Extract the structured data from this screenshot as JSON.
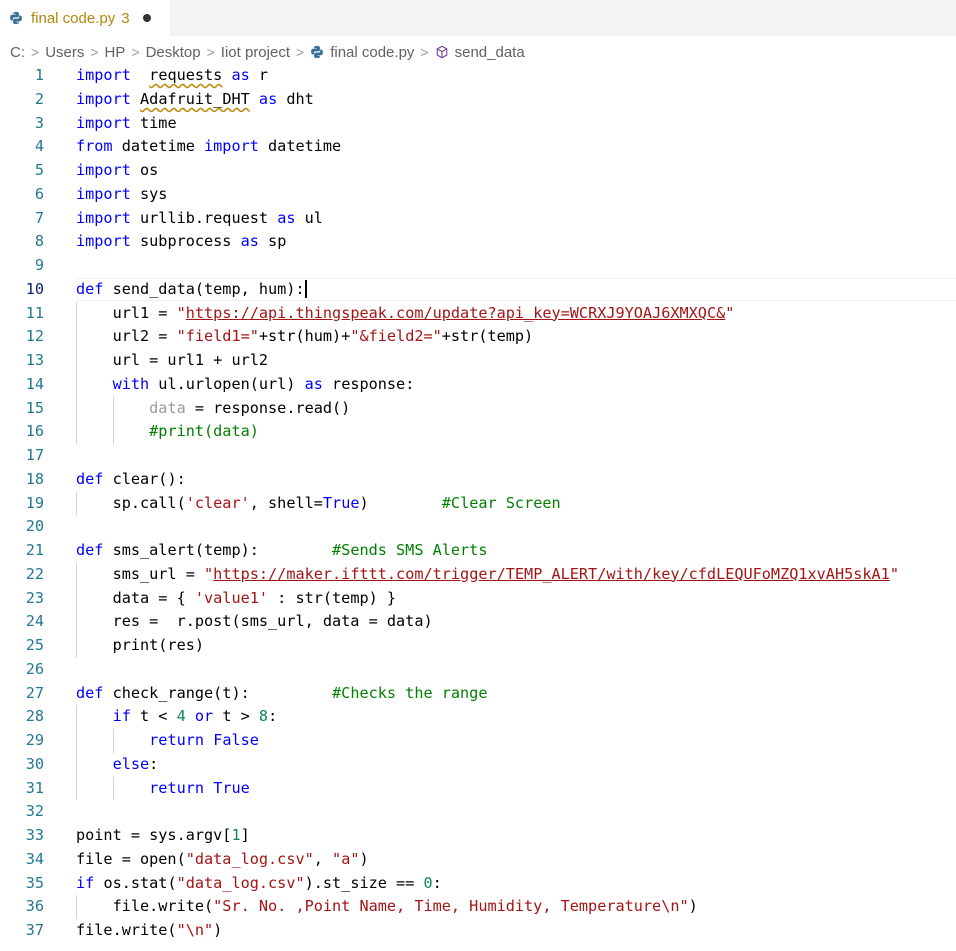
{
  "tab": {
    "filename": "final code.py",
    "problems": "3"
  },
  "breadcrumb": [
    "C:",
    "Users",
    "HP",
    "Desktop",
    "Iiot project",
    "final code.py",
    "send_data"
  ],
  "colors": {
    "keyword": "#0000ff",
    "string": "#a31515",
    "comment": "#008000",
    "number": "#098658",
    "line_number": "#237893"
  },
  "code_lines": [
    {
      "n": "1",
      "t": [
        [
          "kw",
          "import"
        ],
        [
          "",
          "  "
        ],
        [
          "sq",
          "requests"
        ],
        [
          "",
          " "
        ],
        [
          "kw",
          "as"
        ],
        [
          "",
          " r"
        ]
      ]
    },
    {
      "n": "2",
      "t": [
        [
          "kw",
          "import"
        ],
        [
          "",
          " "
        ],
        [
          "sq",
          "Adafruit_DHT"
        ],
        [
          "",
          " "
        ],
        [
          "kw",
          "as"
        ],
        [
          "",
          " dht"
        ]
      ]
    },
    {
      "n": "3",
      "t": [
        [
          "kw",
          "import"
        ],
        [
          "",
          " time"
        ]
      ]
    },
    {
      "n": "4",
      "t": [
        [
          "kw",
          "from"
        ],
        [
          "",
          " datetime "
        ],
        [
          "kw",
          "import"
        ],
        [
          "",
          " datetime"
        ]
      ]
    },
    {
      "n": "5",
      "t": [
        [
          "kw",
          "import"
        ],
        [
          "",
          " os"
        ]
      ]
    },
    {
      "n": "6",
      "t": [
        [
          "kw",
          "import"
        ],
        [
          "",
          " sys"
        ]
      ]
    },
    {
      "n": "7",
      "t": [
        [
          "kw",
          "import"
        ],
        [
          "",
          " urllib.request "
        ],
        [
          "kw",
          "as"
        ],
        [
          "",
          " ul"
        ]
      ]
    },
    {
      "n": "8",
      "t": [
        [
          "kw",
          "import"
        ],
        [
          "",
          " subprocess "
        ],
        [
          "kw",
          "as"
        ],
        [
          "",
          " sp"
        ]
      ]
    },
    {
      "n": "9",
      "t": []
    },
    {
      "n": "10",
      "t": [
        [
          "kw",
          "def"
        ],
        [
          "",
          " send_data(temp, hum):"
        ]
      ]
    },
    {
      "n": "11",
      "t": [
        [
          "",
          "    url1 = "
        ],
        [
          "str",
          "\""
        ],
        [
          "strl",
          "https://api.thingspeak.com/update?api_key=WCRXJ9YOAJ6XMXQC&"
        ],
        [
          "str",
          "\""
        ]
      ]
    },
    {
      "n": "12",
      "t": [
        [
          "",
          "    url2 = "
        ],
        [
          "str",
          "\"field1=\""
        ],
        [
          "",
          "+str(hum)+"
        ],
        [
          "str",
          "\"&field2=\""
        ],
        [
          "",
          "+str(temp)"
        ]
      ]
    },
    {
      "n": "13",
      "t": [
        [
          "",
          "    url = url1 + url2"
        ]
      ]
    },
    {
      "n": "14",
      "t": [
        [
          "",
          "    "
        ],
        [
          "kw",
          "with"
        ],
        [
          "",
          " ul.urlopen(url) "
        ],
        [
          "kw",
          "as"
        ],
        [
          "",
          " response:"
        ]
      ]
    },
    {
      "n": "15",
      "t": [
        [
          "",
          "        "
        ],
        [
          "un",
          "data"
        ],
        [
          "",
          " = response.read()"
        ]
      ]
    },
    {
      "n": "16",
      "t": [
        [
          "",
          "        "
        ],
        [
          "cm",
          "#print(data)"
        ]
      ]
    },
    {
      "n": "17",
      "t": []
    },
    {
      "n": "18",
      "t": [
        [
          "kw",
          "def"
        ],
        [
          "",
          " clear():"
        ]
      ]
    },
    {
      "n": "19",
      "t": [
        [
          "",
          "    sp.call("
        ],
        [
          "str",
          "'clear'"
        ],
        [
          "",
          ", shell="
        ],
        [
          "kw",
          "True"
        ],
        [
          "",
          ")        "
        ],
        [
          "cm",
          "#Clear Screen"
        ]
      ]
    },
    {
      "n": "20",
      "t": []
    },
    {
      "n": "21",
      "t": [
        [
          "kw",
          "def"
        ],
        [
          "",
          " sms_alert(temp):        "
        ],
        [
          "cm",
          "#Sends SMS Alerts"
        ]
      ]
    },
    {
      "n": "22",
      "t": [
        [
          "",
          "    sms_url = "
        ],
        [
          "str",
          "\""
        ],
        [
          "strl",
          "https://maker.ifttt.com/trigger/TEMP_ALERT/with/key/cfdLEQUFoMZQ1xvAH5skA1"
        ],
        [
          "str",
          "\""
        ]
      ]
    },
    {
      "n": "23",
      "t": [
        [
          "",
          "    data = { "
        ],
        [
          "str",
          "'value1'"
        ],
        [
          "",
          " : str(temp) }"
        ]
      ]
    },
    {
      "n": "24",
      "t": [
        [
          "",
          "    res =  r.post(sms_url, data = data)"
        ]
      ]
    },
    {
      "n": "25",
      "t": [
        [
          "",
          "    print(res)"
        ]
      ]
    },
    {
      "n": "26",
      "t": []
    },
    {
      "n": "27",
      "t": [
        [
          "kw",
          "def"
        ],
        [
          "",
          " check_range(t):         "
        ],
        [
          "cm",
          "#Checks the range"
        ]
      ]
    },
    {
      "n": "28",
      "t": [
        [
          "",
          "    "
        ],
        [
          "kw",
          "if"
        ],
        [
          "",
          " t < "
        ],
        [
          "num",
          "4"
        ],
        [
          "",
          " "
        ],
        [
          "kw",
          "or"
        ],
        [
          "",
          " t > "
        ],
        [
          "num",
          "8"
        ],
        [
          "",
          ":"
        ]
      ]
    },
    {
      "n": "29",
      "t": [
        [
          "",
          "        "
        ],
        [
          "kw",
          "return"
        ],
        [
          "",
          " "
        ],
        [
          "kw",
          "False"
        ]
      ]
    },
    {
      "n": "30",
      "t": [
        [
          "",
          "    "
        ],
        [
          "kw",
          "else"
        ],
        [
          "",
          ":"
        ]
      ]
    },
    {
      "n": "31",
      "t": [
        [
          "",
          "        "
        ],
        [
          "kw",
          "return"
        ],
        [
          "",
          " "
        ],
        [
          "kw",
          "True"
        ]
      ]
    },
    {
      "n": "32",
      "t": []
    },
    {
      "n": "33",
      "t": [
        [
          "",
          "point = sys.argv["
        ],
        [
          "num",
          "1"
        ],
        [
          "",
          "]"
        ]
      ]
    },
    {
      "n": "34",
      "t": [
        [
          "",
          "file = open("
        ],
        [
          "str",
          "\"data_log.csv\""
        ],
        [
          "",
          ", "
        ],
        [
          "str",
          "\"a\""
        ],
        [
          "",
          ")"
        ]
      ]
    },
    {
      "n": "35",
      "t": [
        [
          "kw",
          "if"
        ],
        [
          "",
          " os.stat("
        ],
        [
          "str",
          "\"data_log.csv\""
        ],
        [
          "",
          ").st_size == "
        ],
        [
          "num",
          "0"
        ],
        [
          "",
          ":"
        ]
      ]
    },
    {
      "n": "36",
      "t": [
        [
          "",
          "    file.write("
        ],
        [
          "str",
          "\"Sr. No. ,Point Name, Time, Humidity, Temperature\\n\""
        ],
        [
          "",
          ")"
        ]
      ]
    },
    {
      "n": "37",
      "t": [
        [
          "",
          "file.write("
        ],
        [
          "str",
          "\"\\n\""
        ],
        [
          "",
          ")"
        ]
      ]
    }
  ]
}
